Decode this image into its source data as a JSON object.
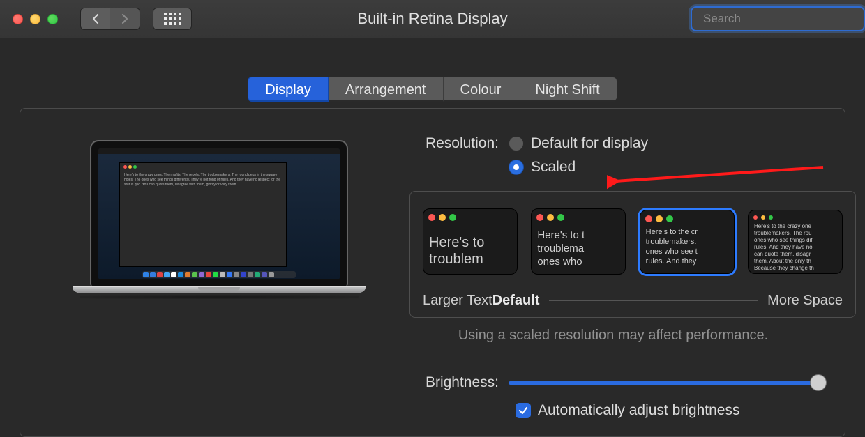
{
  "window": {
    "title": "Built-in Retina Display",
    "search_placeholder": "Search"
  },
  "tabs": [
    {
      "label": "Display",
      "active": true
    },
    {
      "label": "Arrangement",
      "active": false
    },
    {
      "label": "Colour",
      "active": false
    },
    {
      "label": "Night Shift",
      "active": false
    }
  ],
  "resolution": {
    "label": "Resolution:",
    "options": {
      "default": "Default for display",
      "scaled": "Scaled"
    },
    "selected": "scaled",
    "thumb_text_large": "Here's to the crazy ones. The misfits. The rebels. The troublemakers. The round pegs in the square holes.",
    "thumb_caption_larger": "Larger Text",
    "thumb_caption_default": "Default",
    "thumb_caption_more": "More Space",
    "performance_note": "Using a scaled resolution may affect performance."
  },
  "brightness": {
    "label": "Brightness:",
    "auto_label": "Automatically adjust brightness",
    "auto_checked": true
  },
  "preview_doc_text": "Here's to the crazy ones. The misfits. The rebels. The troublemakers. The round pegs in the square holes. The ones who see things differently. They're not fond of rules. And they have no respect for the status quo. You can quote them, disagree with them, glorify or vilify them."
}
